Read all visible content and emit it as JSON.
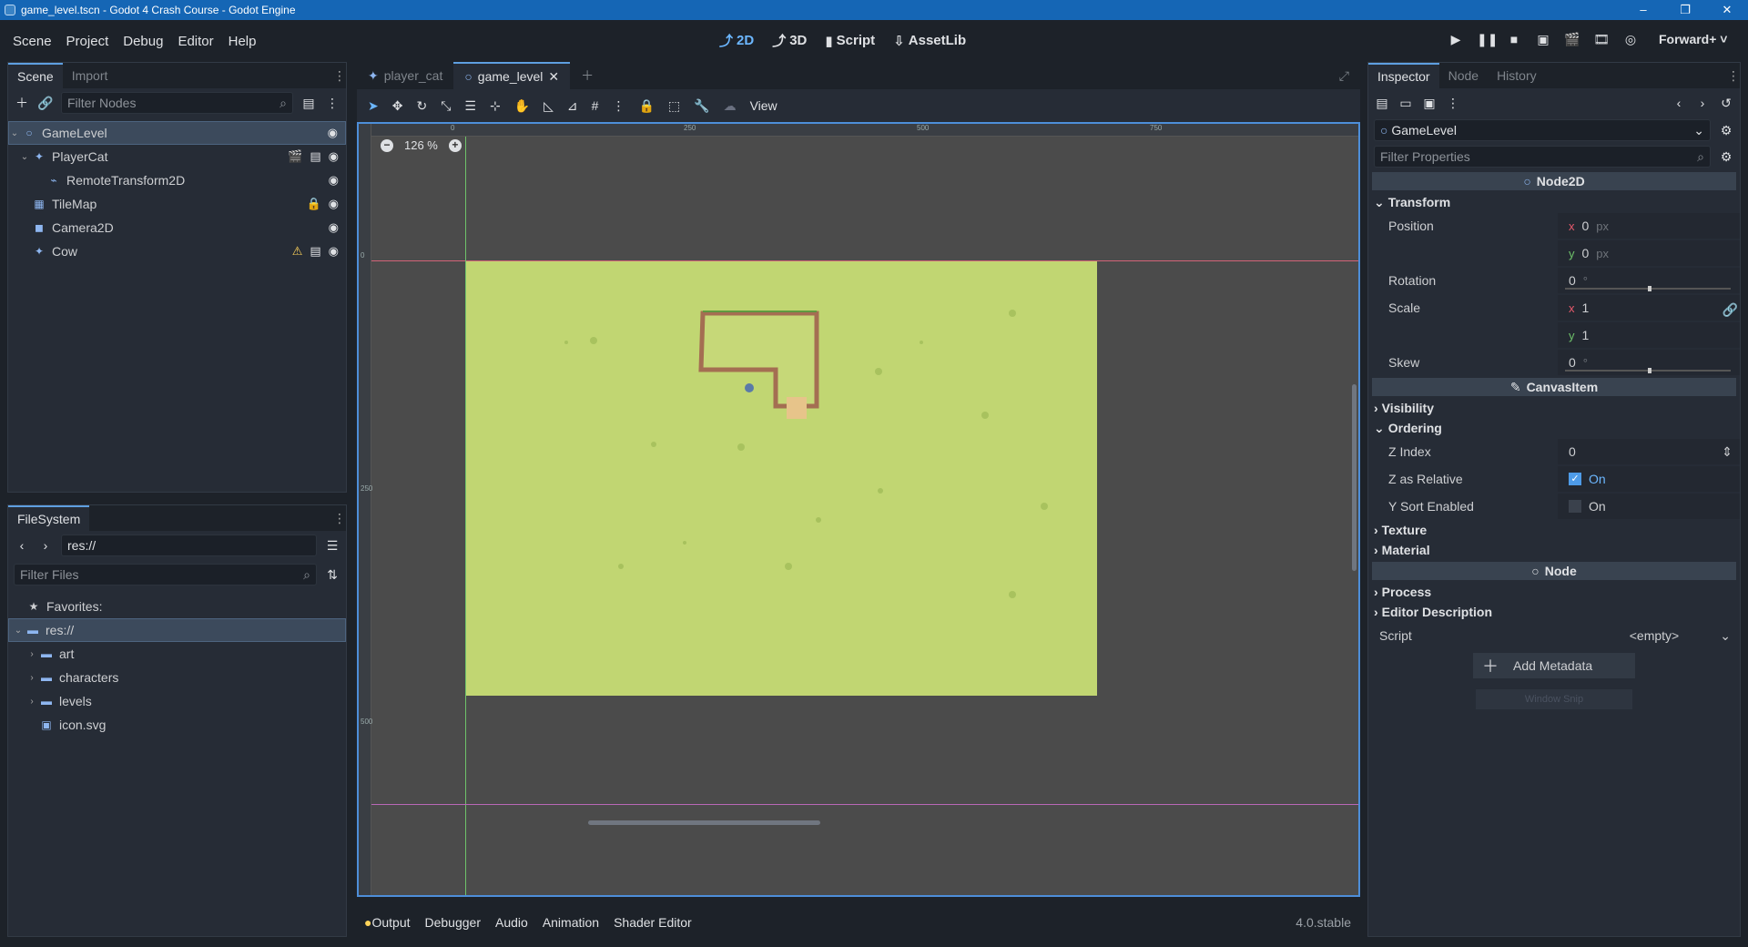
{
  "window": {
    "title": "game_level.tscn - Godot 4 Crash Course - Godot Engine"
  },
  "menu": [
    "Scene",
    "Project",
    "Debug",
    "Editor",
    "Help"
  ],
  "main_screens": [
    "2D",
    "3D",
    "Script",
    "AssetLib"
  ],
  "renderer": "Forward+",
  "scene_dock": {
    "tabs": [
      "Scene",
      "Import"
    ],
    "filter_placeholder": "Filter Nodes",
    "nodes": [
      {
        "name": "GameLevel",
        "icon": "node2d-icon"
      },
      {
        "name": "PlayerCat",
        "icon": "character-icon"
      },
      {
        "name": "RemoteTransform2D",
        "icon": "remote-transform-icon"
      },
      {
        "name": "TileMap",
        "icon": "tilemap-icon"
      },
      {
        "name": "Camera2D",
        "icon": "camera-icon"
      },
      {
        "name": "Cow",
        "icon": "character-icon"
      }
    ]
  },
  "filesystem": {
    "tab": "FileSystem",
    "path": "res://",
    "filter_placeholder": "Filter Files",
    "favorites": "Favorites:",
    "root": "res://",
    "items": [
      "art",
      "characters",
      "levels",
      "icon.svg"
    ]
  },
  "editor": {
    "tabs": [
      "player_cat",
      "game_level"
    ],
    "view_label": "View",
    "zoom": "126 %",
    "ruler_h": [
      "0",
      "250",
      "500",
      "750"
    ],
    "ruler_v": [
      "0",
      "250",
      "500"
    ]
  },
  "bottom_panel": {
    "tabs": [
      "Output",
      "Debugger",
      "Audio",
      "Animation",
      "Shader Editor"
    ],
    "version": "4.0.stable"
  },
  "inspector": {
    "tabs": [
      "Inspector",
      "Node",
      "History"
    ],
    "object": "GameLevel",
    "filter_placeholder": "Filter Properties",
    "class_node2d": "Node2D",
    "transform": "Transform",
    "position_label": "Position",
    "position_x": "0",
    "position_y": "0",
    "px": "px",
    "rotation_label": "Rotation",
    "rotation": "0",
    "scale_label": "Scale",
    "scale_x": "1",
    "scale_y": "1",
    "skew_label": "Skew",
    "skew": "0",
    "canvas_item": "CanvasItem",
    "visibility": "Visibility",
    "ordering": "Ordering",
    "z_index_label": "Z Index",
    "z_index": "0",
    "z_relative_label": "Z as Relative",
    "z_relative": "On",
    "y_sort_label": "Y Sort Enabled",
    "y_sort": "On",
    "texture": "Texture",
    "material": "Material",
    "class_node": "Node",
    "process": "Process",
    "editor_description": "Editor Description",
    "script_label": "Script",
    "script_value": "<empty>",
    "add_metadata": "Add Metadata",
    "snip": "Window Snip"
  }
}
